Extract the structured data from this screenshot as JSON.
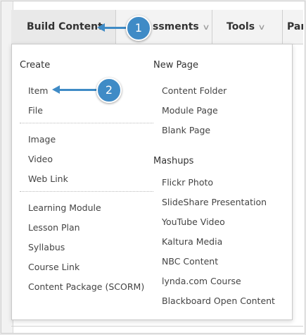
{
  "tabs": {
    "build_content": "Build Content",
    "assessments": "ssments",
    "tools": "Tools",
    "partners": "Par"
  },
  "create": {
    "header": "Create",
    "group1": [
      "Item",
      "File"
    ],
    "group2": [
      "Image",
      "Video",
      "Web Link"
    ],
    "group3": [
      "Learning Module",
      "Lesson Plan",
      "Syllabus",
      "Course Link",
      "Content Package (SCORM)"
    ]
  },
  "new_page": {
    "header": "New Page",
    "items": [
      "Content Folder",
      "Module Page",
      "Blank Page"
    ]
  },
  "mashups": {
    "header": "Mashups",
    "items": [
      "Flickr Photo",
      "SlideShare Presentation",
      "YouTube Video",
      "Kaltura Media",
      "NBC Content",
      "lynda.com Course",
      "Blackboard Open Content"
    ]
  },
  "callouts": {
    "step1": "1",
    "step2": "2",
    "color": "#3f8bc6"
  }
}
